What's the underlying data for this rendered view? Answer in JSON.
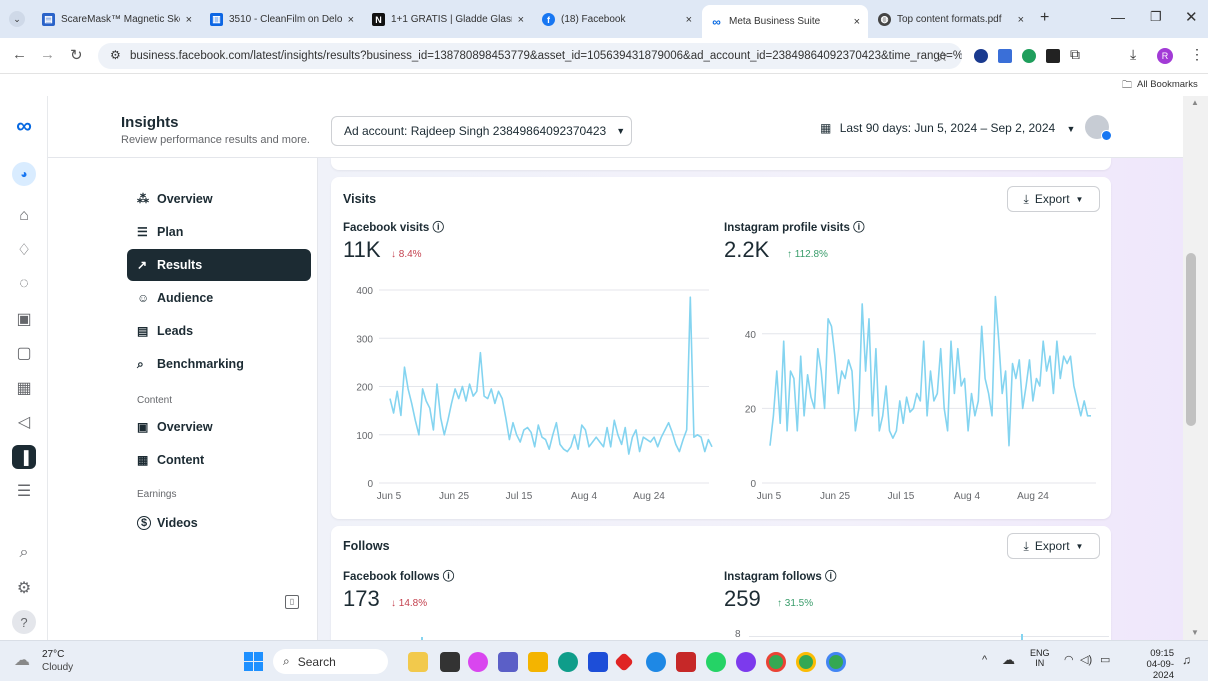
{
  "browser": {
    "tabs": [
      {
        "title": "ScareMask™ Magnetic Ske",
        "icon": "doc-icon",
        "color": "#2a63c9",
        "close": "×"
      },
      {
        "title": "3510 - CleanFilm on Deloz",
        "icon": "trello-icon",
        "color": "#0c66e4",
        "close": "×"
      },
      {
        "title": "1+1 GRATIS | Gladde Glasr",
        "icon": "n-icon",
        "color": "#111111",
        "close": "×"
      },
      {
        "title": "(18) Facebook",
        "icon": "facebook-icon",
        "color": "#1877f2",
        "close": "×"
      },
      {
        "title": "Meta Business Suite",
        "icon": "meta-icon",
        "color": "#0668e1",
        "close": "×"
      },
      {
        "title": "Top content formats.pdf",
        "icon": "globe-icon",
        "color": "#444444",
        "close": "×"
      }
    ],
    "new_tab": "+",
    "url": "business.facebook.com/latest/insights/results?business_id=138780898453779&asset_id=105639431879006&ad_account_id=23849864092370423&time_range=%...",
    "bookmarks_label": "All Bookmarks"
  },
  "header": {
    "title": "Insights",
    "subtitle": "Review performance results and more.",
    "ad_account": "Ad account: Rajdeep Singh 23849864092370423",
    "date_range": "Last 90 days: Jun 5, 2024 – Sep 2, 2024"
  },
  "sidebar": {
    "items": [
      {
        "label": "Overview",
        "icon": "overview-icon",
        "glyph": "⁂"
      },
      {
        "label": "Plan",
        "icon": "plan-icon",
        "glyph": "☰"
      },
      {
        "label": "Results",
        "icon": "results-icon",
        "glyph": "↗",
        "active": true
      },
      {
        "label": "Audience",
        "icon": "audience-icon",
        "glyph": "☺"
      },
      {
        "label": "Leads",
        "icon": "leads-icon",
        "glyph": "▤"
      },
      {
        "label": "Benchmarking",
        "icon": "benchmarking-icon",
        "glyph": "⌕"
      }
    ],
    "content_section": "Content",
    "content_items": [
      {
        "label": "Overview",
        "icon": "content-overview-icon",
        "glyph": "▣"
      },
      {
        "label": "Content",
        "icon": "content-table-icon",
        "glyph": "▦"
      }
    ],
    "earnings_section": "Earnings",
    "earnings_items": [
      {
        "label": "Videos",
        "icon": "dollar-icon",
        "glyph": "$"
      }
    ]
  },
  "visits": {
    "title": "Visits",
    "export": "Export",
    "facebook": {
      "label": "Facebook visits",
      "value": "11K",
      "delta": "↓ 8.4%"
    },
    "instagram": {
      "label": "Instagram profile visits",
      "value": "2.2K",
      "delta": "↑ 112.8%"
    }
  },
  "follows": {
    "title": "Follows",
    "export": "Export",
    "facebook": {
      "label": "Facebook follows",
      "value": "173",
      "delta": "↓ 14.8%"
    },
    "instagram": {
      "label": "Instagram follows",
      "value": "259",
      "delta": "↑ 31.5%"
    },
    "ig_axis_tick": "8"
  },
  "chart_data": [
    {
      "type": "line",
      "name": "Facebook visits",
      "color": "#84d4f0",
      "x_ticks": [
        "Jun 5",
        "Jun 25",
        "Jul 15",
        "Aug 4",
        "Aug 24"
      ],
      "y_ticks": [
        0,
        100,
        200,
        300,
        400
      ],
      "ylim": [
        0,
        400
      ],
      "values": [
        175,
        145,
        190,
        140,
        240,
        195,
        165,
        130,
        100,
        195,
        170,
        155,
        110,
        205,
        135,
        100,
        130,
        165,
        195,
        175,
        200,
        170,
        205,
        180,
        190,
        270,
        180,
        175,
        195,
        165,
        190,
        175,
        135,
        90,
        125,
        100,
        85,
        110,
        115,
        105,
        75,
        120,
        95,
        90,
        70,
        100,
        125,
        80,
        70,
        65,
        75,
        100,
        70,
        120,
        110,
        75,
        85,
        95,
        85,
        75,
        115,
        75,
        130,
        100,
        80,
        115,
        60,
        95,
        110,
        65,
        95,
        90,
        85,
        95,
        75,
        95,
        110,
        125,
        105,
        80,
        65,
        90,
        110,
        385,
        95,
        100,
        95,
        65,
        90,
        75
      ]
    },
    {
      "type": "line",
      "name": "Instagram profile visits",
      "color": "#84d4f0",
      "x_ticks": [
        "Jun 5",
        "Jun 25",
        "Jul 15",
        "Aug 4",
        "Aug 24"
      ],
      "y_ticks": [
        0,
        20,
        40
      ],
      "ylim": [
        0,
        52
      ],
      "values": [
        10,
        18,
        30,
        16,
        38,
        14,
        30,
        28,
        14,
        34,
        18,
        29,
        23,
        20,
        36,
        30,
        20,
        44,
        42,
        34,
        24,
        30,
        28,
        33,
        30,
        14,
        20,
        48,
        30,
        44,
        18,
        36,
        14,
        18,
        26,
        14,
        12,
        14,
        22,
        16,
        23,
        19,
        20,
        24,
        22,
        38,
        18,
        30,
        22,
        24,
        36,
        20,
        14,
        38,
        24,
        36,
        26,
        28,
        14,
        24,
        18,
        22,
        42,
        28,
        24,
        18,
        50,
        38,
        24,
        30,
        10,
        32,
        28,
        33,
        20,
        26,
        33,
        22,
        28,
        26,
        38,
        30,
        34,
        24,
        38,
        28,
        34,
        32,
        34,
        26,
        22,
        18,
        22,
        18,
        18
      ]
    }
  ],
  "taskbar": {
    "weather_temp": "27°C",
    "weather_desc": "Cloudy",
    "search": "Search",
    "lang_top": "ENG",
    "lang_bottom": "IN",
    "time": "09:15",
    "date": "04-09-2024"
  }
}
